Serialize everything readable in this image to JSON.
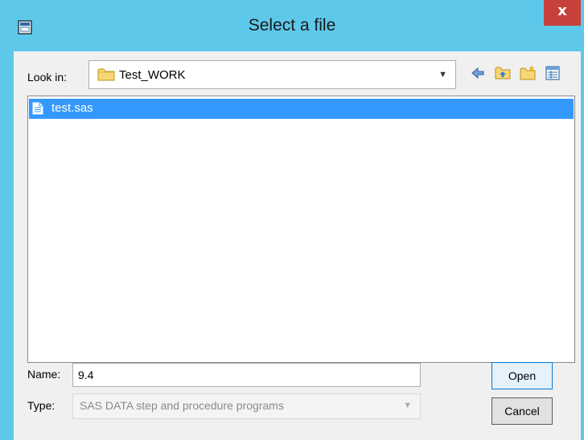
{
  "window": {
    "title": "Select a file",
    "close_label": "x"
  },
  "toolbar": {
    "look_in_label": "Look in:",
    "look_in_value": "Test_WORK"
  },
  "files": [
    {
      "name": "test.sas",
      "selected": true
    }
  ],
  "form": {
    "name_label": "Name:",
    "name_value": "9.4",
    "type_label": "Type:",
    "type_value": "SAS DATA step and procedure programs"
  },
  "buttons": {
    "open_label": "Open",
    "cancel_label": "Cancel"
  },
  "colors": {
    "titlebar": "#5ec8ea",
    "selection": "#3399ff",
    "close": "#c7403a"
  }
}
